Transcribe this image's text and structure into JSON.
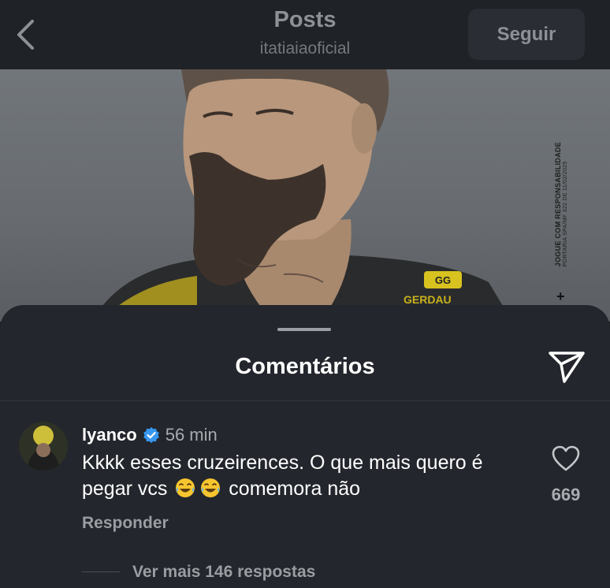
{
  "header": {
    "title": "Posts",
    "subtitle": "itatiaiaoficial",
    "follow_label": "Seguir",
    "back_icon": "chevron-left-icon"
  },
  "photo": {
    "side_text": "JOGUE COM RESPONSABILIDADE",
    "side_subtext": "PORTARIA SPA/MF 322 DE 11/02/2025",
    "sponsor_badge": "GG",
    "sponsor_text": "GERDAU",
    "age_mark": "+"
  },
  "comments_sheet": {
    "title": "Comentários",
    "send_icon": "paper-plane-icon"
  },
  "comment": {
    "username": "lyanco",
    "verified": true,
    "time": "56 min",
    "text_before": "Kkkk esses cruzeirences. O que mais quero é pegar vcs",
    "text_after": "comemora não",
    "emojis": [
      "tears-of-joy-emoji",
      "tears-of-joy-emoji"
    ],
    "reply_label": "Responder",
    "like_count": "669",
    "more_replies_label": "Ver mais 146 respostas"
  },
  "colors": {
    "background": "#1c1f24",
    "sheet": "#23262c",
    "verified_blue": "#3797f0",
    "muted_text": "#a8abb0"
  }
}
